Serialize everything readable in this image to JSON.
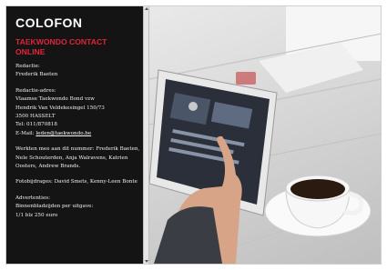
{
  "colofon": {
    "title": "COLOFON",
    "subtitle": "TAEKWONDO CONTACT ONLINE",
    "redactie_label": "Redactie:",
    "redactie_name": "Frederik Baeten",
    "adres_label": "Redactie-adres:",
    "adres_org": "Vlaamse Taekwondo Bond vzw",
    "adres_street": "Hendrik Van Veldekesingel 150/73",
    "adres_city": "3500 HASSELT",
    "tel": "Tel: 011/870818",
    "email_prefix": "E-Mail: ",
    "email_link": "leden@taekwondo.be",
    "contributors": "Werkten mee aan dit nummer: Frederik Baeten, Nele Schouterden, Anja Walravens, Katrien Oosters, Andrew Brands.",
    "photos": "Fotobijdrages: David Smets, Kenny-Leen Bonte",
    "ads_label": "Advertenties:",
    "ads_line1": "Binnenbladzijden per uitgave:",
    "ads_line2": "1/1 blz 250 euro"
  },
  "photo": {
    "icon": "tablet-coffee-photo",
    "colors": {
      "table": "#d8d8d6",
      "tablet": "#e3e3e3",
      "screen": "#2b2f3a",
      "sleeve": "#3a3d44",
      "skin": "#d7a487",
      "coffee": "#2a1a10",
      "cup": "#f7f7f7"
    }
  }
}
